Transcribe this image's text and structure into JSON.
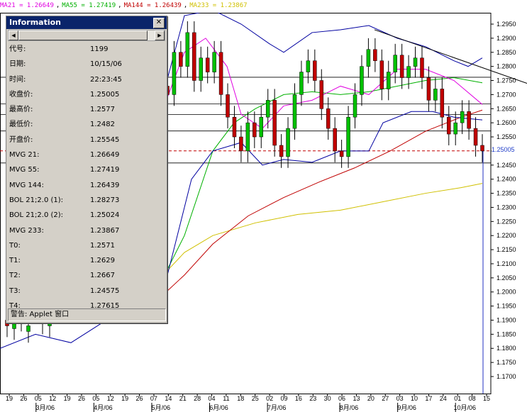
{
  "legend": [
    {
      "text": "MA21 = 1.26649",
      "color": "#e000e0"
    },
    {
      "text": "MA55 = 1.27419",
      "color": "#00b000"
    },
    {
      "text": "MA144 = 1.26439",
      "color": "#c00000"
    },
    {
      "text": "MA233 = 1.23867",
      "color": "#d0c000"
    }
  ],
  "info": {
    "title": "Information",
    "close_label": "✕",
    "rows": [
      {
        "label": "代号:",
        "value": "1199"
      },
      {
        "label": "日期:",
        "value": "10/15/06"
      },
      {
        "label": "时间:",
        "value": "22:23:45"
      },
      {
        "label": "收盘价:",
        "value": "1.25005"
      },
      {
        "label": "最高价:",
        "value": "1.2577"
      },
      {
        "label": "最低价:",
        "value": "1.2482"
      },
      {
        "label": "开盘价:",
        "value": "1.25545"
      },
      {
        "label": "MVG 21:",
        "value": "1.26649"
      },
      {
        "label": "MVG 55:",
        "value": "1.27419"
      },
      {
        "label": "MVG 144:",
        "value": "1.26439"
      },
      {
        "label": "BOL 21;2.0 (1):",
        "value": "1.28273"
      },
      {
        "label": "BOL 21;2.0 (2):",
        "value": "1.25024"
      },
      {
        "label": "MVG 233:",
        "value": "1.23867"
      },
      {
        "label": "T0:",
        "value": "1.2571"
      },
      {
        "label": "T1:",
        "value": "1.2629"
      },
      {
        "label": "T2:",
        "value": "1.2667"
      },
      {
        "label": "T3:",
        "value": "1.24575"
      },
      {
        "label": "T4:",
        "value": "1.27615"
      }
    ],
    "warning": "警告: Applet 窗口"
  },
  "price_tag": "1.25005",
  "chart_data": {
    "type": "candlestick",
    "ylim": [
      1.165,
      1.2975
    ],
    "yticks": [
      "1.2950",
      "1.2900",
      "1.2850",
      "1.2800",
      "1.2750",
      "1.2700",
      "1.2650",
      "1.2600",
      "1.2550",
      "1.2500",
      "1.2450",
      "1.2400",
      "1.2350",
      "1.2300",
      "1.2250",
      "1.2200",
      "1.2150",
      "1.2100",
      "1.2050",
      "1.2000",
      "1.1950",
      "1.1900",
      "1.1850",
      "1.1800",
      "1.1750",
      "1.1700"
    ],
    "x_day_ticks": [
      "19",
      "26",
      "05",
      "12",
      "19",
      "26",
      "05",
      "12",
      "19",
      "26",
      "07",
      "14",
      "21",
      "28",
      "04",
      "11",
      "18",
      "25",
      "02",
      "09",
      "16",
      "23",
      "30",
      "06",
      "13",
      "20",
      "27",
      "03",
      "10",
      "17",
      "24",
      "01",
      "08",
      "15"
    ],
    "x_month_ticks": [
      {
        "label": "3月/06",
        "index": 2
      },
      {
        "label": "4月/06",
        "index": 6
      },
      {
        "label": "5月/06",
        "index": 10
      },
      {
        "label": "6月/06",
        "index": 14
      },
      {
        "label": "7月/06",
        "index": 18
      },
      {
        "label": "8月/06",
        "index": 23
      },
      {
        "label": "9月/06",
        "index": 27
      },
      {
        "label": "10月/06",
        "index": 31
      }
    ],
    "horizontal_levels": [
      {
        "name": "T0",
        "value": 1.2571
      },
      {
        "name": "T1",
        "value": 1.2629
      },
      {
        "name": "T2",
        "value": 1.2667
      },
      {
        "name": "T3",
        "value": 1.24575
      },
      {
        "name": "T4",
        "value": 1.27615
      }
    ],
    "last_close": 1.25005,
    "colors": {
      "up": "#00c000",
      "down": "#c00000",
      "bollinger": "#0000a0",
      "ma21": "#e000e0",
      "ma55": "#00b000",
      "ma144": "#c00000",
      "ma233": "#d0c000",
      "trend": "#000000"
    }
  }
}
